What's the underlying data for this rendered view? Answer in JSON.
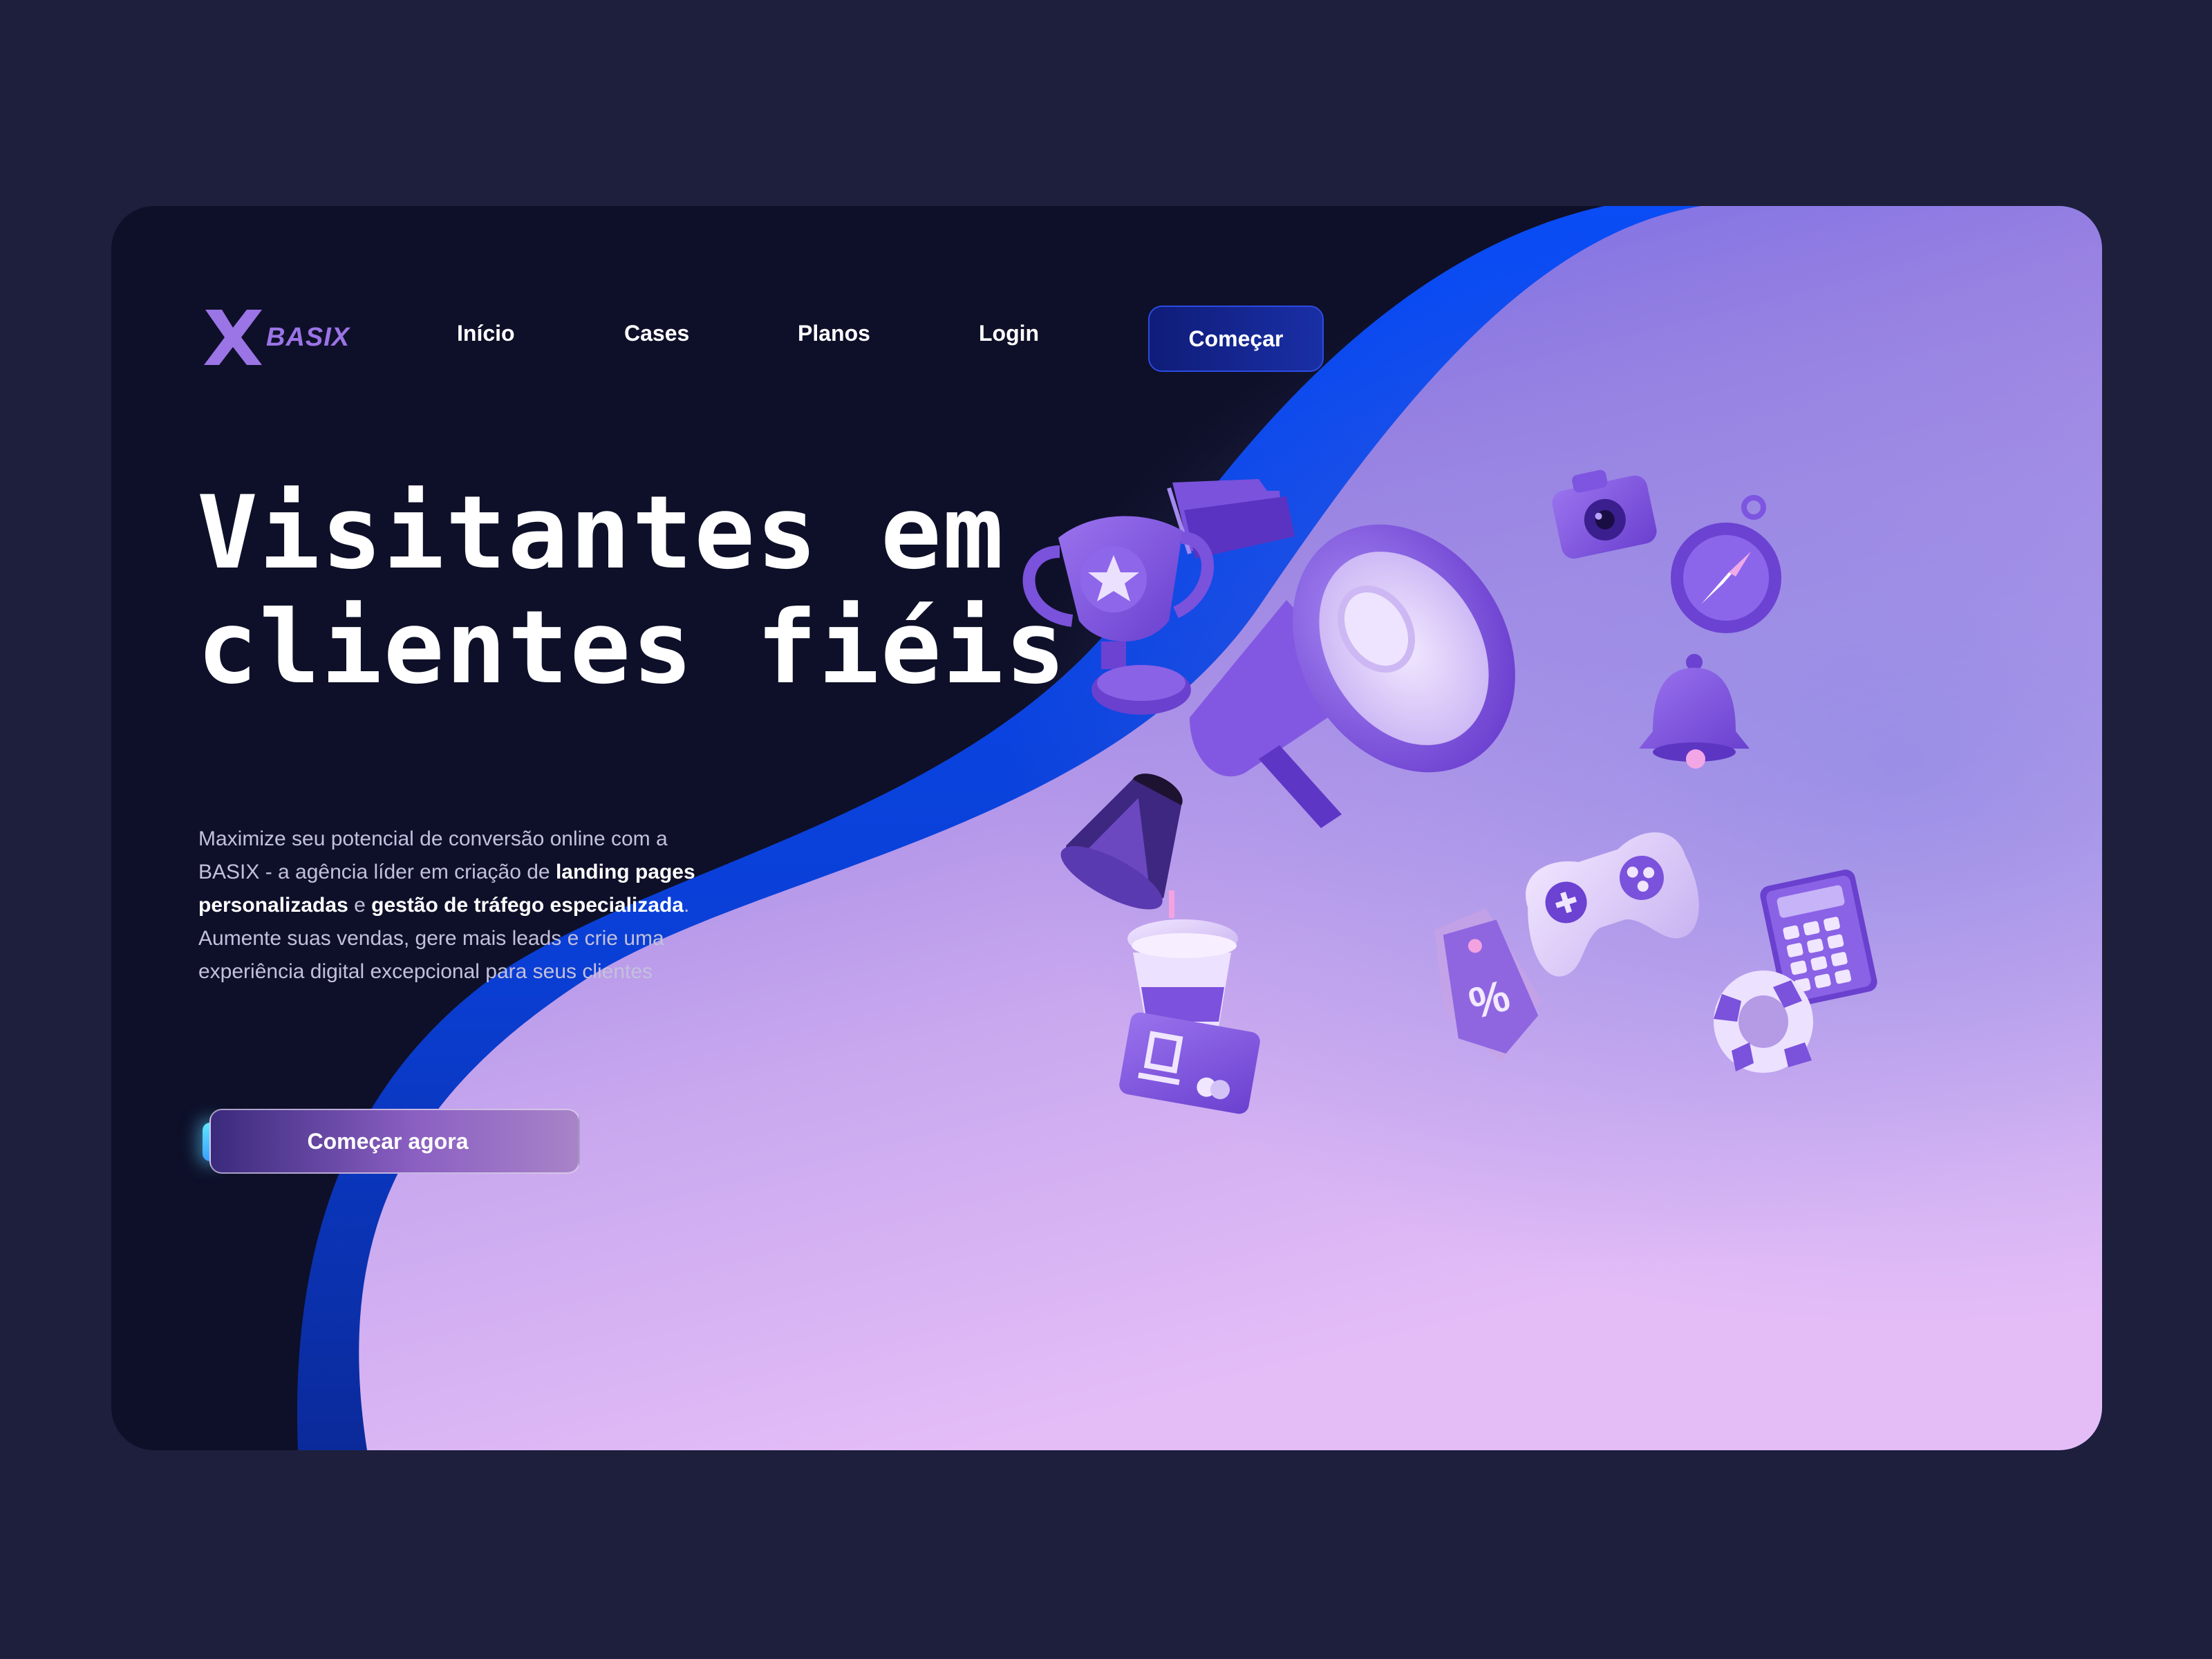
{
  "brand": {
    "name": "BASIX"
  },
  "nav": {
    "items": [
      {
        "label": "Início"
      },
      {
        "label": "Cases"
      },
      {
        "label": "Planos"
      },
      {
        "label": "Login"
      }
    ],
    "cta_label": "Começar"
  },
  "hero": {
    "title_line1": "Visitantes em",
    "title_line2": "clientes fiéis",
    "desc": {
      "part1": "Maximize seu potencial de conversão online com a BASIX - a agência líder em criação de ",
      "bold1": "landing pages personalizadas",
      "part2": " e ",
      "bold2": "gestão de tráfego especializada",
      "part3": ". Aumente suas vendas, gere mais leads e crie uma experiência digital excepcional para seus clientes"
    },
    "cta_label": "Começar agora"
  },
  "illustration": {
    "icons": [
      "folder-icon",
      "camera-icon",
      "trophy-icon",
      "megaphone-icon",
      "compass-icon",
      "bell-icon",
      "cone-icon",
      "coffee-cup-icon",
      "price-tag-icon",
      "gamepad-icon",
      "calculator-icon",
      "credit-card-icon",
      "lifebuoy-icon"
    ],
    "price_tag_text": "%"
  },
  "colors": {
    "page_bg": "#1d1f3c",
    "card_dark": "#0e1029",
    "blue_wave": "#0a4cf5",
    "purple_top": "#6a5ee3",
    "lavender_bottom": "#e3b9f6",
    "accent_purple": "#9b74e6",
    "icon_purple": "#7a4fd6"
  }
}
